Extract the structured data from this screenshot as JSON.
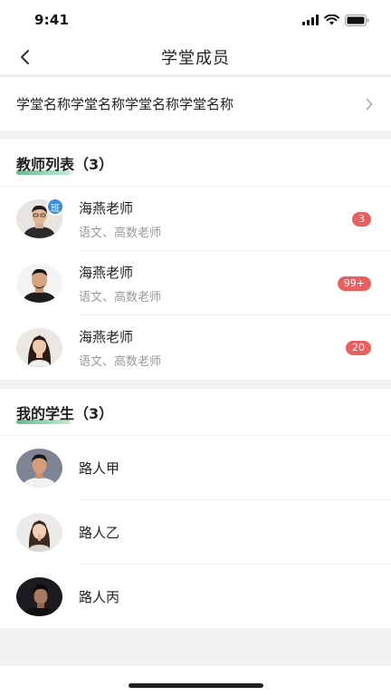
{
  "status_bar": {
    "time": "9:41"
  },
  "nav": {
    "title": "学堂成员"
  },
  "school": {
    "name": "学堂名称学堂名称学堂名称学堂名称"
  },
  "teachers": {
    "title": "教师列表（3）",
    "items": [
      {
        "name": "海燕老师",
        "subjects": "语文、高数老师",
        "badge": "3",
        "tag": "班"
      },
      {
        "name": "海燕老师",
        "subjects": "语文、高数老师",
        "badge": "99+"
      },
      {
        "name": "海燕老师",
        "subjects": "语文、高数老师",
        "badge": "20"
      }
    ]
  },
  "students": {
    "title": "我的学生（3）",
    "items": [
      {
        "name": "路人甲"
      },
      {
        "name": "路人乙"
      },
      {
        "name": "路人丙"
      }
    ]
  },
  "colors": {
    "accent_green": "#4caf7d",
    "badge_red": "#e9605f",
    "tag_blue": "#3b8bd9"
  }
}
